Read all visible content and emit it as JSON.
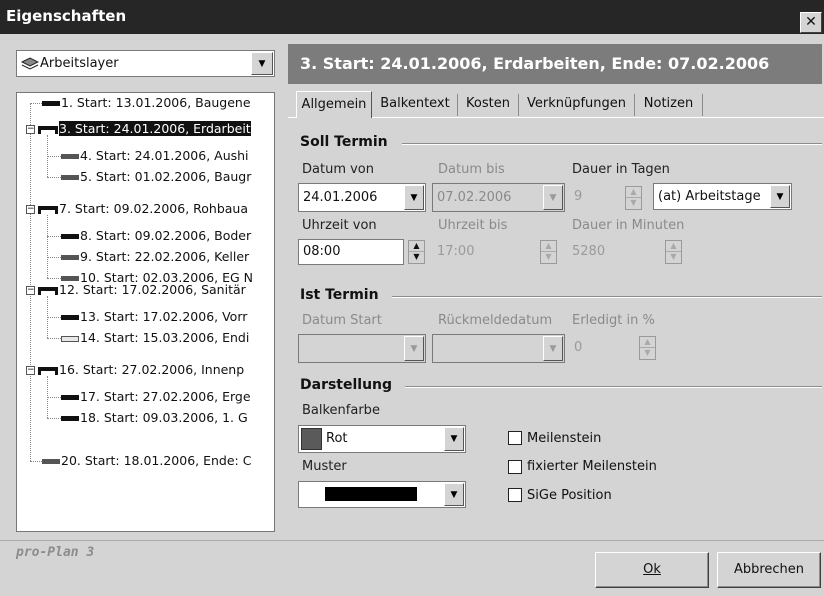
{
  "window": {
    "title": "Eigenschaften",
    "close_label": "✕"
  },
  "layer_select": {
    "value": "Arbeitslayer",
    "icon": "layers-icon"
  },
  "header": {
    "title": "3. Start: 24.01.2006, Erdarbeiten, Ende: 07.02.2006"
  },
  "tree": {
    "items": [
      {
        "label": "1. Start: 13.01.2006, Baugene"
      },
      {
        "label": "3. Start: 24.01.2006, Erdarbeit"
      },
      {
        "label": "4. Start: 24.01.2006, Aushi"
      },
      {
        "label": "5. Start: 01.02.2006, Baugr"
      },
      {
        "label": "7. Start: 09.02.2006, Rohbaua"
      },
      {
        "label": "8. Start: 09.02.2006, Boder"
      },
      {
        "label": "9. Start: 22.02.2006, Keller"
      },
      {
        "label": "10. Start: 02.03.2006, EG N"
      },
      {
        "label": "12. Start: 17.02.2006, Sanitär"
      },
      {
        "label": "13. Start: 17.02.2006, Vorr"
      },
      {
        "label": "14. Start: 15.03.2006, Endi"
      },
      {
        "label": "16. Start: 27.02.2006, Innenp"
      },
      {
        "label": "17. Start: 27.02.2006, Erge"
      },
      {
        "label": "18. Start: 09.03.2006, 1. G"
      },
      {
        "label": "20. Start: 18.01.2006, Ende: C"
      }
    ],
    "selected": "3. Start: 24.01.2006, Erdarbeit"
  },
  "tabs": [
    "Allgemein",
    "Balkentext",
    "Kosten",
    "Verknüpfungen",
    "Notizen"
  ],
  "soll": {
    "title": "Soll Termin",
    "datum_von_label": "Datum von",
    "datum_von": "24.01.2006",
    "datum_bis_label": "Datum bis",
    "datum_bis": "07.02.2006",
    "dauer_tage_label": "Dauer in Tagen",
    "dauer_tage": "9",
    "arbeitstage": "(at) Arbeitstage",
    "uhrzeit_von_label": "Uhrzeit von",
    "uhrzeit_von": "08:00",
    "uhrzeit_bis_label": "Uhrzeit bis",
    "uhrzeit_bis": "17:00",
    "dauer_min_label": "Dauer in Minuten",
    "dauer_min": "5280"
  },
  "ist": {
    "title": "Ist Termin",
    "datum_start_label": "Datum Start",
    "rueckmelde_label": "Rückmeldedatum",
    "erledigt_label": "Erledigt in %",
    "erledigt": "0"
  },
  "darstellung": {
    "title": "Darstellung",
    "farbe_label": "Balkenfarbe",
    "farbe": "Rot",
    "farbe_swatch": "#5a5a5a",
    "muster_label": "Muster",
    "meilenstein": "Meilenstein",
    "fix_meilenstein": "fixierter Meilenstein",
    "sige": "SiGe Position"
  },
  "footer": {
    "brand": "pro-Plan 3",
    "ok": "Ok",
    "cancel": "Abbrechen"
  }
}
